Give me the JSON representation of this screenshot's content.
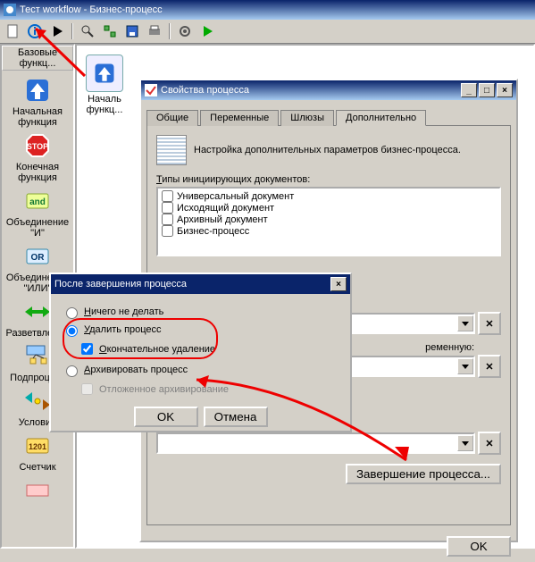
{
  "window": {
    "title": "Тест workflow - Бизнес-процесс"
  },
  "toolbar": {
    "icons": [
      "doc",
      "info",
      "play",
      "sep",
      "zoom",
      "pick",
      "save",
      "print",
      "sep",
      "gear",
      "run"
    ]
  },
  "sidebar": {
    "tab_label": "Базовые функц...",
    "items": [
      {
        "label": "Начальная функция",
        "icon": "arrow-up-blue"
      },
      {
        "label": "Конечная функция",
        "icon": "stop-red"
      },
      {
        "label": "Объединение \"И\"",
        "icon": "and-green"
      },
      {
        "label": "Объединение \"ИЛИ\"",
        "icon": "or-blue"
      },
      {
        "label": "Разветвление",
        "icon": "split-green"
      },
      {
        "label": "Подпроцесс",
        "icon": "sub-blue"
      },
      {
        "label": "Условие",
        "icon": "cond-arrows"
      },
      {
        "label": "Счетчик",
        "icon": "counter-yellow"
      },
      {
        "label": "",
        "icon": "more"
      }
    ]
  },
  "canvas": {
    "node": {
      "label_line1": "Началь",
      "label_line2": "функц..."
    }
  },
  "props": {
    "title": "Свойства процесса",
    "tabs": {
      "general": "Общие",
      "vars": "Переменные",
      "gateways": "Шлюзы",
      "advanced": "Дополнительно"
    },
    "info_text": "Настройка дополнительных параметров бизнес-процесса.",
    "types_label": "Типы инициирующих документов:",
    "types": [
      "Универсальный документ",
      "Исходящий документ",
      "Архивный документ",
      "Бизнес-процесс"
    ],
    "var_label_suffix": "ременную:",
    "completion_btn": "Завершение процесса...",
    "ok": "OK"
  },
  "after": {
    "title": "После завершения процесса",
    "opt_nothing": "Ничего не делать",
    "opt_delete": "Удалить процесс",
    "opt_delete_final": "Окончательное удаление",
    "opt_archive": "Архивировать процесс",
    "opt_deferred": "Отложенное архивирование",
    "ok": "OK",
    "cancel": "Отмена"
  }
}
